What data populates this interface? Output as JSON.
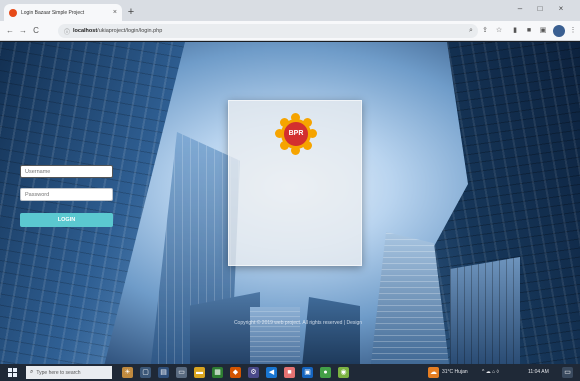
{
  "browser": {
    "tab_title": "Login Bazaar Simple Project",
    "tab_close": "×",
    "new_tab": "+",
    "window_controls": [
      "–",
      "□",
      "×"
    ],
    "nav": {
      "back": "←",
      "forward": "→",
      "reload": "C",
      "info": "ⓘ"
    },
    "url_host": "localhost",
    "url_path": "/ukiaproject/login/login.php",
    "toolbar_icons": [
      "search-icon",
      "share-icon",
      "star-icon",
      "extensions-icon",
      "puzzle-icon",
      "sidebar-icon"
    ]
  },
  "login": {
    "logo_text": "BPR",
    "username_placeholder": "Username",
    "password_placeholder": "Password",
    "login_label": "LOGIN",
    "footer": "Copyright © 2019 web project. All rights reserved | Design"
  },
  "taskbar": {
    "search_placeholder": "Type here to search",
    "weather": "31°C Hujan",
    "tray": "^ ☁ ⌂ ◊",
    "time": "11:04 AM"
  },
  "colors": {
    "login_button": "#5bc8d0",
    "logo_red": "#d32f2f",
    "logo_gold": "#f6a400",
    "taskbar_bg": "#1f2937"
  }
}
